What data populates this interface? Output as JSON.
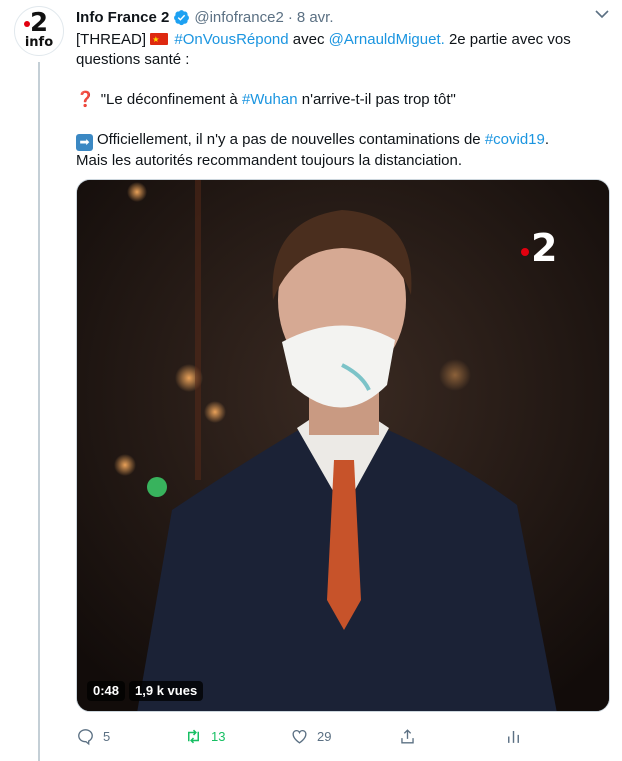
{
  "tweet": {
    "author_name": "Info France 2",
    "handle": "@infofrance2",
    "separator": "·",
    "date": "8 avr.",
    "avatar": {
      "number": "2",
      "subtitle": "info"
    },
    "line1_prefix": "[THREAD]",
    "hashtag_onvousrepond": "#OnVousRépond",
    "word_avec": "avec",
    "mention": "@ArnauldMiguet.",
    "line1_suffix": "2e partie avec vos questions santé :",
    "quote_prefix": "\"Le déconfinement à",
    "hashtag_wuhan": "#Wuhan",
    "quote_suffix": "n'arrive-t-il pas trop tôt\"",
    "answer_prefix": "Officiellement, il n'y a pas de nouvelles contaminations de",
    "hashtag_covid": "#covid19",
    "answer_period": ".",
    "answer_line2": "Mais les autorités recommandent toujours la distanciation."
  },
  "video": {
    "duration": "0:48",
    "views": "1,9 k vues",
    "channel_logo": "2"
  },
  "actions": {
    "replies": "5",
    "retweets": "13",
    "likes": "29"
  },
  "icons": [
    "verified-badge-icon",
    "chevron-down-icon",
    "question-mark-icon",
    "right-arrow-icon",
    "reply-icon",
    "retweet-icon",
    "like-icon",
    "share-icon",
    "analytics-icon"
  ],
  "colors": {
    "link": "#1b95e0",
    "retweet_active": "#17bf63",
    "muted": "#5b7083",
    "france2_red": "#e1000f"
  }
}
